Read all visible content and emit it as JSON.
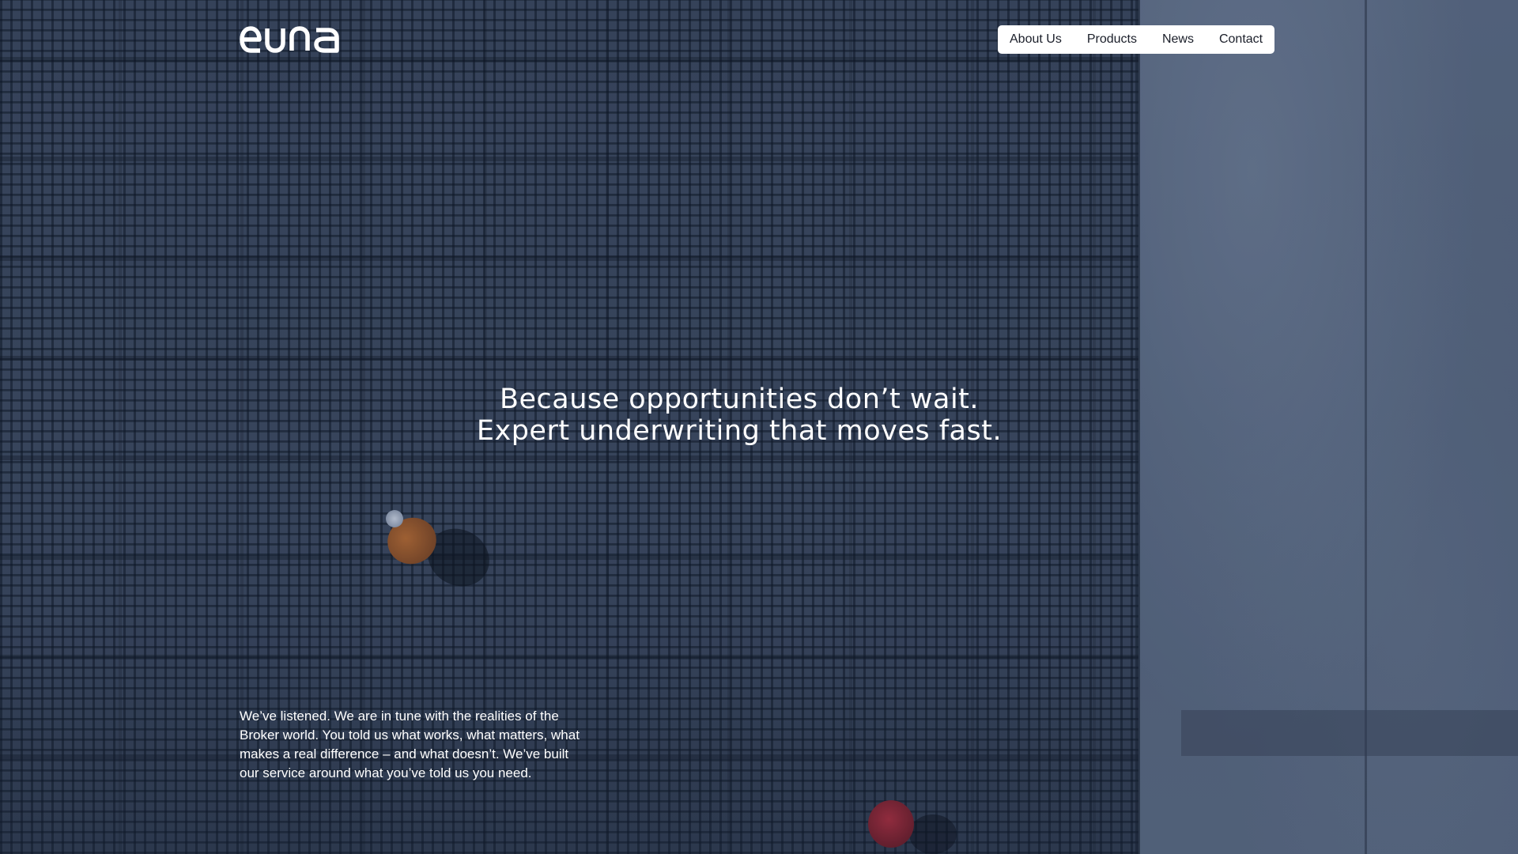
{
  "brand": {
    "logo_text": "euna",
    "logo_color": "#ffffff"
  },
  "nav": {
    "items": [
      {
        "label": "About Us"
      },
      {
        "label": "Products"
      },
      {
        "label": "News"
      },
      {
        "label": "Contact"
      }
    ]
  },
  "hero": {
    "headline_line1": "Because opportunities don’t wait.",
    "headline_line2": "Expert underwriting that moves fast.",
    "intro": "We’ve listened. We are in tune with the realities of the Broker world. You told us what works, what matters, what makes a real difference – and what doesn’t. We’ve built our service around what you’ve told us you need."
  },
  "colors": {
    "nav_background": "#ffffff",
    "nav_text": "#1b1f2a",
    "hero_text": "#ffffff",
    "overlay": "#3b4659"
  }
}
